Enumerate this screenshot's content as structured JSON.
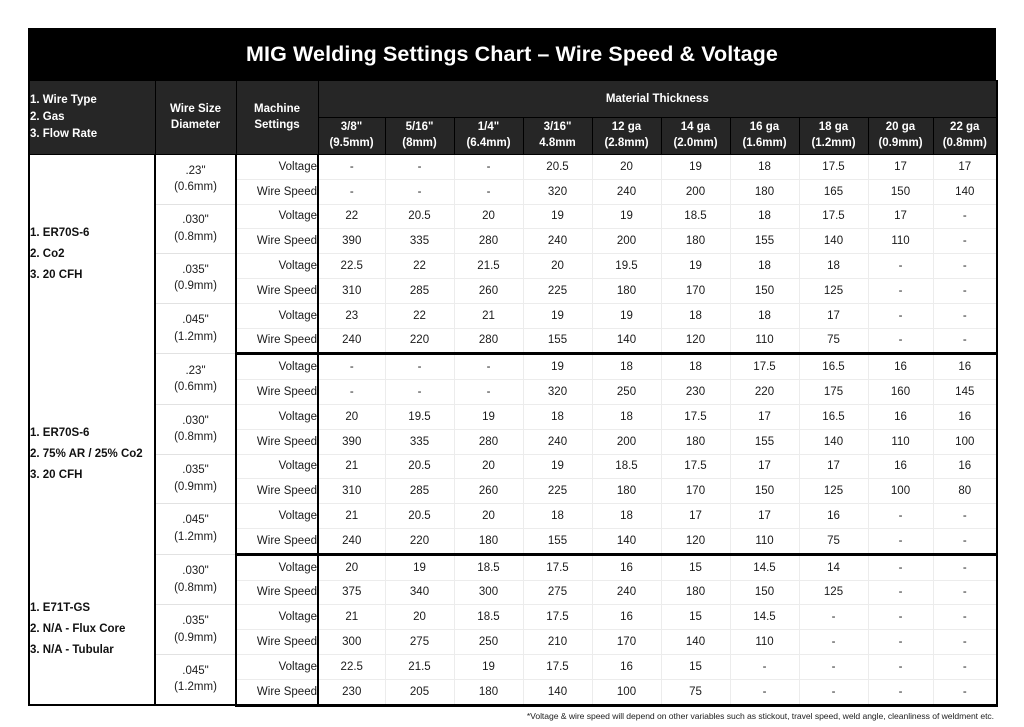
{
  "title": "MIG Welding Settings Chart – Wire Speed & Voltage",
  "header": {
    "spec_col": {
      "line1": "1. Wire Type",
      "line2": "2. Gas",
      "line3": "3. Flow Rate"
    },
    "wire_size_col": {
      "line1": "Wire Size",
      "line2": "Diameter"
    },
    "machine_settings_col": {
      "line1": "Machine",
      "line2": "Settings"
    },
    "material_thickness_group": "Material Thickness",
    "thickness_columns": [
      {
        "label": "3/8\"",
        "metric": "(9.5mm)"
      },
      {
        "label": "5/16\"",
        "metric": "(8mm)"
      },
      {
        "label": "1/4\"",
        "metric": "(6.4mm)"
      },
      {
        "label": "3/16\"",
        "metric": "4.8mm"
      },
      {
        "label": "12 ga",
        "metric": "(2.8mm)"
      },
      {
        "label": "14 ga",
        "metric": "(2.0mm)"
      },
      {
        "label": "16 ga",
        "metric": "(1.6mm)"
      },
      {
        "label": "18 ga",
        "metric": "(1.2mm)"
      },
      {
        "label": "20 ga",
        "metric": "(0.9mm)"
      },
      {
        "label": "22 ga",
        "metric": "(0.8mm)"
      }
    ]
  },
  "setting_labels": {
    "voltage": "Voltage",
    "wire_speed": "Wire Speed"
  },
  "blocks": [
    {
      "spec": {
        "line1": "1. ER70S-6",
        "line2": "2. Co2",
        "line3": "3. 20 CFH"
      },
      "wires": [
        {
          "size": ".23\"",
          "metric": "(0.6mm)",
          "voltage": [
            "-",
            "-",
            "-",
            "20.5",
            "20",
            "19",
            "18",
            "17.5",
            "17",
            "17"
          ],
          "wire_speed": [
            "-",
            "-",
            "-",
            "320",
            "240",
            "200",
            "180",
            "165",
            "150",
            "140"
          ]
        },
        {
          "size": ".030\"",
          "metric": "(0.8mm)",
          "voltage": [
            "22",
            "20.5",
            "20",
            "19",
            "19",
            "18.5",
            "18",
            "17.5",
            "17",
            "-"
          ],
          "wire_speed": [
            "390",
            "335",
            "280",
            "240",
            "200",
            "180",
            "155",
            "140",
            "110",
            "-"
          ]
        },
        {
          "size": ".035\"",
          "metric": "(0.9mm)",
          "voltage": [
            "22.5",
            "22",
            "21.5",
            "20",
            "19.5",
            "19",
            "18",
            "18",
            "-",
            "-"
          ],
          "wire_speed": [
            "310",
            "285",
            "260",
            "225",
            "180",
            "170",
            "150",
            "125",
            "-",
            "-"
          ]
        },
        {
          "size": ".045\"",
          "metric": "(1.2mm)",
          "voltage": [
            "23",
            "22",
            "21",
            "19",
            "19",
            "18",
            "18",
            "17",
            "-",
            "-"
          ],
          "wire_speed": [
            "240",
            "220",
            "280",
            "155",
            "140",
            "120",
            "110",
            "75",
            "-",
            "-"
          ]
        }
      ]
    },
    {
      "spec": {
        "line1": "1. ER70S-6",
        "line2": "2. 75% AR / 25% Co2",
        "line3": "3. 20 CFH"
      },
      "wires": [
        {
          "size": ".23\"",
          "metric": "(0.6mm)",
          "voltage": [
            "-",
            "-",
            "-",
            "19",
            "18",
            "18",
            "17.5",
            "16.5",
            "16",
            "16"
          ],
          "wire_speed": [
            "-",
            "-",
            "-",
            "320",
            "250",
            "230",
            "220",
            "175",
            "160",
            "145"
          ]
        },
        {
          "size": ".030\"",
          "metric": "(0.8mm)",
          "voltage": [
            "20",
            "19.5",
            "19",
            "18",
            "18",
            "17.5",
            "17",
            "16.5",
            "16",
            "16"
          ],
          "wire_speed": [
            "390",
            "335",
            "280",
            "240",
            "200",
            "180",
            "155",
            "140",
            "110",
            "100"
          ]
        },
        {
          "size": ".035\"",
          "metric": "(0.9mm)",
          "voltage": [
            "21",
            "20.5",
            "20",
            "19",
            "18.5",
            "17.5",
            "17",
            "17",
            "16",
            "16"
          ],
          "wire_speed": [
            "310",
            "285",
            "260",
            "225",
            "180",
            "170",
            "150",
            "125",
            "100",
            "80"
          ]
        },
        {
          "size": ".045\"",
          "metric": "(1.2mm)",
          "voltage": [
            "21",
            "20.5",
            "20",
            "18",
            "18",
            "17",
            "17",
            "16",
            "-",
            "-"
          ],
          "wire_speed": [
            "240",
            "220",
            "180",
            "155",
            "140",
            "120",
            "110",
            "75",
            "-",
            "-"
          ]
        }
      ]
    },
    {
      "spec": {
        "line1": "1. E71T-GS",
        "line2": "2. N/A - Flux Core",
        "line3": "3. N/A - Tubular"
      },
      "wires": [
        {
          "size": ".030\"",
          "metric": "(0.8mm)",
          "voltage": [
            "20",
            "19",
            "18.5",
            "17.5",
            "16",
            "15",
            "14.5",
            "14",
            "-",
            "-"
          ],
          "wire_speed": [
            "375",
            "340",
            "300",
            "275",
            "240",
            "180",
            "150",
            "125",
            "-",
            "-"
          ]
        },
        {
          "size": ".035\"",
          "metric": "(0.9mm)",
          "voltage": [
            "21",
            "20",
            "18.5",
            "17.5",
            "16",
            "15",
            "14.5",
            "-",
            "-",
            "-"
          ],
          "wire_speed": [
            "300",
            "275",
            "250",
            "210",
            "170",
            "140",
            "110",
            "-",
            "-",
            "-"
          ]
        },
        {
          "size": ".045\"",
          "metric": "(1.2mm)",
          "voltage": [
            "22.5",
            "21.5",
            "19",
            "17.5",
            "16",
            "15",
            "-",
            "-",
            "-",
            "-"
          ],
          "wire_speed": [
            "230",
            "205",
            "180",
            "140",
            "100",
            "75",
            "-",
            "-",
            "-",
            "-"
          ]
        }
      ]
    }
  ],
  "footnote": "*Voltage & wire speed will depend on other variables such as stickout, travel speed, weld angle, cleanliness of weldment etc.",
  "colors": {
    "title_bar": "#000000",
    "header_bg": "#262626",
    "header_text": "#ffffff",
    "body_bg": "#ffffff",
    "body_text": "#1a1a1a",
    "rule": "#000000"
  }
}
